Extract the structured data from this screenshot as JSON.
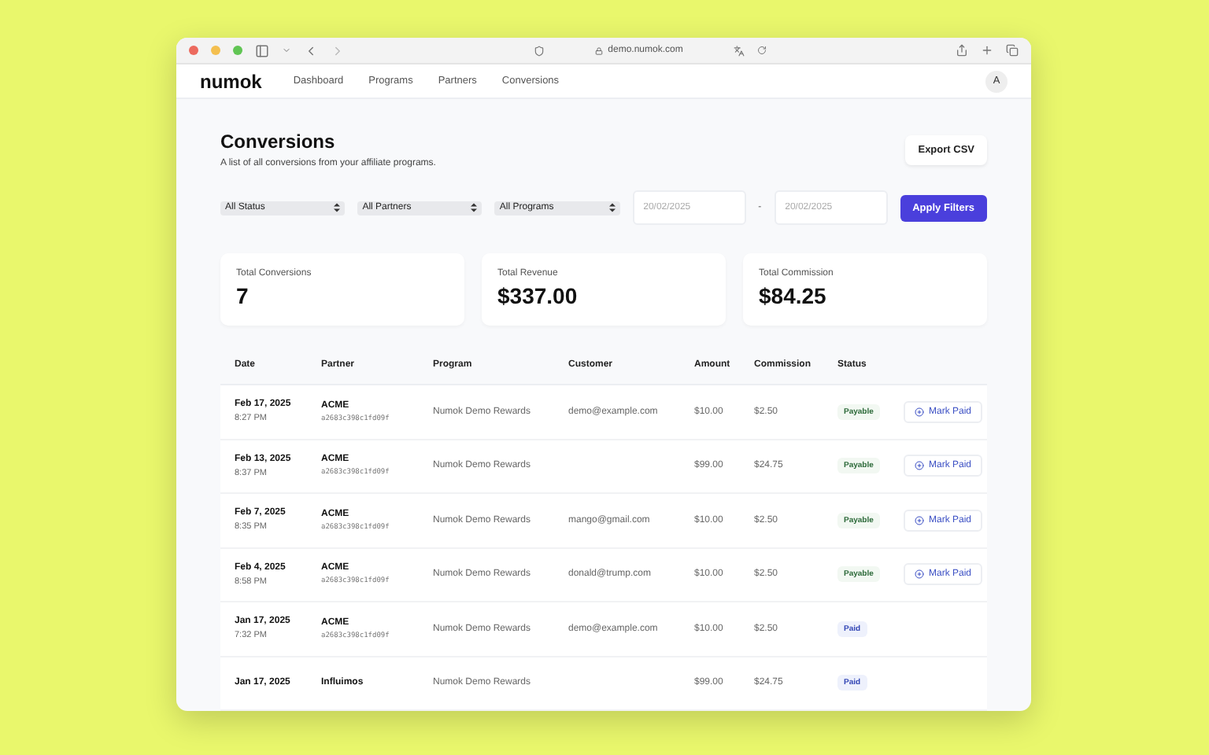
{
  "browser": {
    "url": "demo.numok.com"
  },
  "nav": {
    "logo": "numok",
    "links": [
      "Dashboard",
      "Programs",
      "Partners",
      "Conversions"
    ],
    "avatar": "A"
  },
  "header": {
    "title": "Conversions",
    "subtitle": "A list of all conversions from your affiliate programs.",
    "export_button": "Export CSV"
  },
  "filters": {
    "selects": [
      "All Status",
      "All Partners",
      "All Programs"
    ],
    "date_from": "20/02/2025",
    "separator": "-",
    "date_to": "20/02/2025",
    "apply_button": "Apply Filters"
  },
  "stats": [
    {
      "label": "Total Conversions",
      "value": "7"
    },
    {
      "label": "Total Revenue",
      "value": "$337.00"
    },
    {
      "label": "Total Commission",
      "value": "$84.25"
    }
  ],
  "table": {
    "columns": [
      "Date",
      "Partner",
      "Program",
      "Customer",
      "Amount",
      "Commission",
      "Status"
    ],
    "rows": [
      {
        "date": "Feb 17, 2025",
        "time": "8:27 PM",
        "partner": "ACME",
        "partner_id": "a2683c398c1fd09f",
        "program": "Numok Demo Rewards",
        "customer": "demo@example.com",
        "amount": "$10.00",
        "commission": "$2.50",
        "status": "Payable",
        "kind": "payable",
        "action": "Mark Paid"
      },
      {
        "date": "Feb 13, 2025",
        "time": "8:37 PM",
        "partner": "ACME",
        "partner_id": "a2683c398c1fd09f",
        "program": "Numok Demo Rewards",
        "customer": "",
        "amount": "$99.00",
        "commission": "$24.75",
        "status": "Payable",
        "kind": "payable",
        "action": "Mark Paid"
      },
      {
        "date": "Feb 7, 2025",
        "time": "8:35 PM",
        "partner": "ACME",
        "partner_id": "a2683c398c1fd09f",
        "program": "Numok Demo Rewards",
        "customer": "mango@gmail.com",
        "amount": "$10.00",
        "commission": "$2.50",
        "status": "Payable",
        "kind": "payable",
        "action": "Mark Paid"
      },
      {
        "date": "Feb 4, 2025",
        "time": "8:58 PM",
        "partner": "ACME",
        "partner_id": "a2683c398c1fd09f",
        "program": "Numok Demo Rewards",
        "customer": "donald@trump.com",
        "amount": "$10.00",
        "commission": "$2.50",
        "status": "Payable",
        "kind": "payable",
        "action": "Mark Paid"
      },
      {
        "date": "Jan 17, 2025",
        "time": "7:32 PM",
        "partner": "ACME",
        "partner_id": "a2683c398c1fd09f",
        "program": "Numok Demo Rewards",
        "customer": "demo@example.com",
        "amount": "$10.00",
        "commission": "$2.50",
        "status": "Paid",
        "kind": "paid"
      },
      {
        "date": "Jan 17, 2025",
        "partner": "Influimos",
        "program": "Numok Demo Rewards",
        "customer": "",
        "amount": "$99.00",
        "commission": "$24.75",
        "status": "Paid",
        "kind": "paid"
      }
    ]
  }
}
